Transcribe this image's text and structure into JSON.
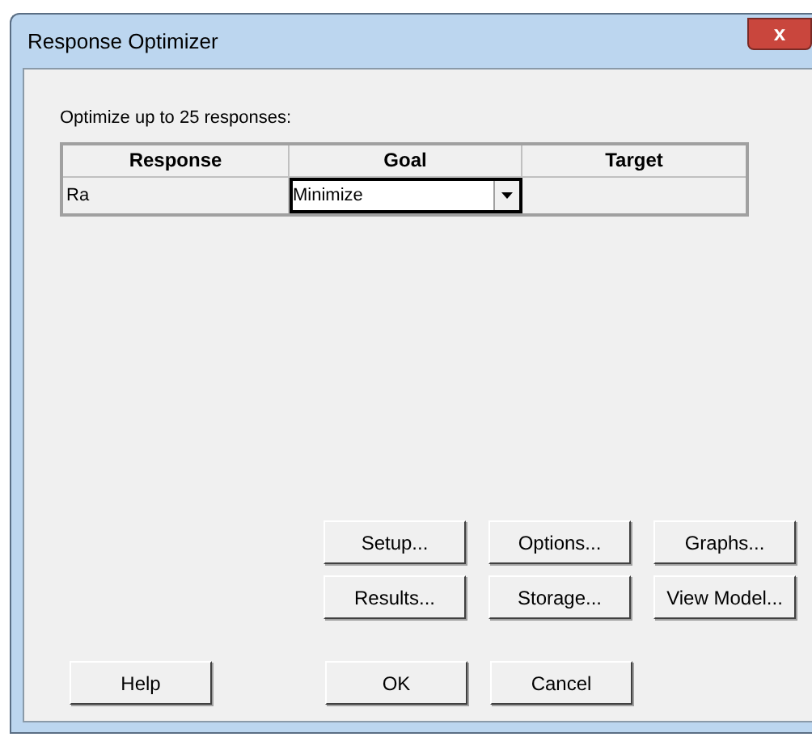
{
  "window": {
    "title": "Response Optimizer",
    "close": "x"
  },
  "prompt": "Optimize up to 25 responses:",
  "table": {
    "columns": [
      "Response",
      "Goal",
      "Target"
    ],
    "rows": [
      {
        "response": "Ra",
        "goal": "Minimize"
      }
    ]
  },
  "buttons_row1": [
    "Setup...",
    "Options...",
    "Graphs..."
  ],
  "buttons_row2": [
    "Results...",
    "Storage...",
    "View Model..."
  ],
  "help": "Help",
  "dialog_buttons": [
    "OK",
    "Cancel"
  ]
}
